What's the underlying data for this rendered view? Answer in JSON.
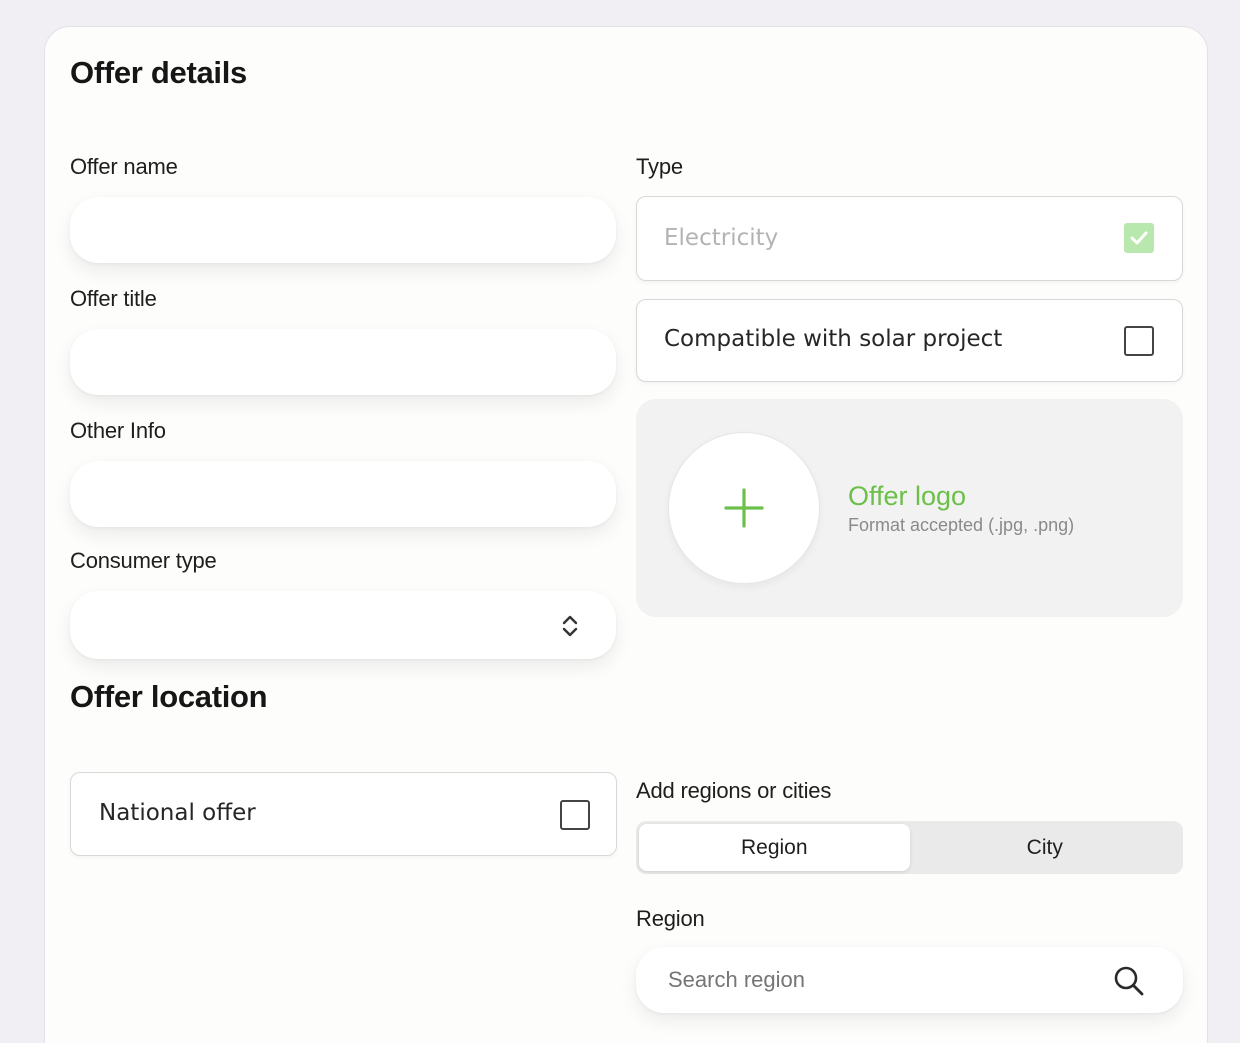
{
  "offer_details": {
    "title": "Offer details",
    "offer_name": {
      "label": "Offer name",
      "value": "",
      "placeholder": ""
    },
    "offer_title": {
      "label": "Offer title",
      "value": "",
      "placeholder": ""
    },
    "other_info": {
      "label": "Other Info",
      "value": "",
      "placeholder": ""
    },
    "consumer_type": {
      "label": "Consumer type",
      "value": ""
    },
    "type": {
      "label": "Type",
      "electricity": {
        "label": "Electricity",
        "checked": true
      },
      "solar": {
        "label": "Compatible with solar project",
        "checked": false
      }
    },
    "logo": {
      "title": "Offer logo",
      "formats": "Format accepted (.jpg, .png)",
      "accent_color": "#6cc04a"
    }
  },
  "offer_location": {
    "title": "Offer location",
    "national_offer": {
      "label": "National offer",
      "checked": false
    },
    "add_regions": {
      "label": "Add regions or cities",
      "tabs": [
        {
          "label": "Region",
          "active": true
        },
        {
          "label": "City",
          "active": false
        }
      ]
    },
    "region": {
      "label": "Region",
      "placeholder": "Search region",
      "icon": "search-icon"
    }
  }
}
